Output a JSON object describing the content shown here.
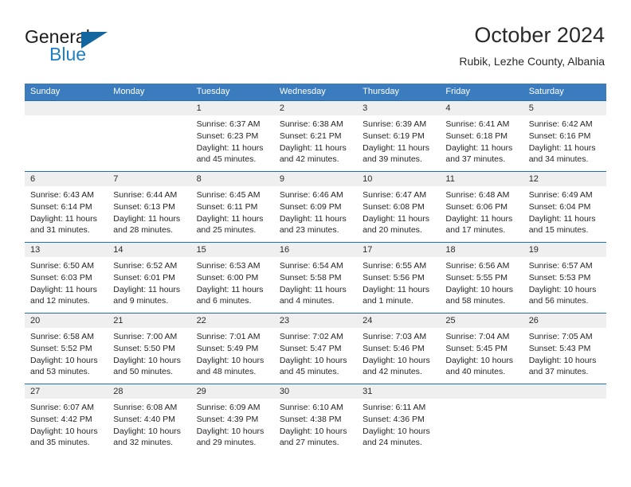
{
  "brand": {
    "name_part1": "General",
    "name_part2": "Blue",
    "accent_color": "#1f7fc4",
    "triangle_color": "#14679e"
  },
  "header": {
    "title": "October 2024",
    "subtitle": "Rubik, Lezhe County, Albania"
  },
  "calendar": {
    "header_bg": "#3a7cbe",
    "row_divider_color": "#1f6db5",
    "daynum_bg": "#efefef",
    "weekdays": [
      "Sunday",
      "Monday",
      "Tuesday",
      "Wednesday",
      "Thursday",
      "Friday",
      "Saturday"
    ],
    "weeks": [
      {
        "daynums": [
          "",
          "",
          "1",
          "2",
          "3",
          "4",
          "5"
        ],
        "cells": [
          {
            "sunrise": "",
            "sunset": "",
            "daylight": ""
          },
          {
            "sunrise": "",
            "sunset": "",
            "daylight": ""
          },
          {
            "sunrise": "Sunrise: 6:37 AM",
            "sunset": "Sunset: 6:23 PM",
            "daylight": "Daylight: 11 hours and 45 minutes."
          },
          {
            "sunrise": "Sunrise: 6:38 AM",
            "sunset": "Sunset: 6:21 PM",
            "daylight": "Daylight: 11 hours and 42 minutes."
          },
          {
            "sunrise": "Sunrise: 6:39 AM",
            "sunset": "Sunset: 6:19 PM",
            "daylight": "Daylight: 11 hours and 39 minutes."
          },
          {
            "sunrise": "Sunrise: 6:41 AM",
            "sunset": "Sunset: 6:18 PM",
            "daylight": "Daylight: 11 hours and 37 minutes."
          },
          {
            "sunrise": "Sunrise: 6:42 AM",
            "sunset": "Sunset: 6:16 PM",
            "daylight": "Daylight: 11 hours and 34 minutes."
          }
        ]
      },
      {
        "daynums": [
          "6",
          "7",
          "8",
          "9",
          "10",
          "11",
          "12"
        ],
        "cells": [
          {
            "sunrise": "Sunrise: 6:43 AM",
            "sunset": "Sunset: 6:14 PM",
            "daylight": "Daylight: 11 hours and 31 minutes."
          },
          {
            "sunrise": "Sunrise: 6:44 AM",
            "sunset": "Sunset: 6:13 PM",
            "daylight": "Daylight: 11 hours and 28 minutes."
          },
          {
            "sunrise": "Sunrise: 6:45 AM",
            "sunset": "Sunset: 6:11 PM",
            "daylight": "Daylight: 11 hours and 25 minutes."
          },
          {
            "sunrise": "Sunrise: 6:46 AM",
            "sunset": "Sunset: 6:09 PM",
            "daylight": "Daylight: 11 hours and 23 minutes."
          },
          {
            "sunrise": "Sunrise: 6:47 AM",
            "sunset": "Sunset: 6:08 PM",
            "daylight": "Daylight: 11 hours and 20 minutes."
          },
          {
            "sunrise": "Sunrise: 6:48 AM",
            "sunset": "Sunset: 6:06 PM",
            "daylight": "Daylight: 11 hours and 17 minutes."
          },
          {
            "sunrise": "Sunrise: 6:49 AM",
            "sunset": "Sunset: 6:04 PM",
            "daylight": "Daylight: 11 hours and 15 minutes."
          }
        ]
      },
      {
        "daynums": [
          "13",
          "14",
          "15",
          "16",
          "17",
          "18",
          "19"
        ],
        "cells": [
          {
            "sunrise": "Sunrise: 6:50 AM",
            "sunset": "Sunset: 6:03 PM",
            "daylight": "Daylight: 11 hours and 12 minutes."
          },
          {
            "sunrise": "Sunrise: 6:52 AM",
            "sunset": "Sunset: 6:01 PM",
            "daylight": "Daylight: 11 hours and 9 minutes."
          },
          {
            "sunrise": "Sunrise: 6:53 AM",
            "sunset": "Sunset: 6:00 PM",
            "daylight": "Daylight: 11 hours and 6 minutes."
          },
          {
            "sunrise": "Sunrise: 6:54 AM",
            "sunset": "Sunset: 5:58 PM",
            "daylight": "Daylight: 11 hours and 4 minutes."
          },
          {
            "sunrise": "Sunrise: 6:55 AM",
            "sunset": "Sunset: 5:56 PM",
            "daylight": "Daylight: 11 hours and 1 minute."
          },
          {
            "sunrise": "Sunrise: 6:56 AM",
            "sunset": "Sunset: 5:55 PM",
            "daylight": "Daylight: 10 hours and 58 minutes."
          },
          {
            "sunrise": "Sunrise: 6:57 AM",
            "sunset": "Sunset: 5:53 PM",
            "daylight": "Daylight: 10 hours and 56 minutes."
          }
        ]
      },
      {
        "daynums": [
          "20",
          "21",
          "22",
          "23",
          "24",
          "25",
          "26"
        ],
        "cells": [
          {
            "sunrise": "Sunrise: 6:58 AM",
            "sunset": "Sunset: 5:52 PM",
            "daylight": "Daylight: 10 hours and 53 minutes."
          },
          {
            "sunrise": "Sunrise: 7:00 AM",
            "sunset": "Sunset: 5:50 PM",
            "daylight": "Daylight: 10 hours and 50 minutes."
          },
          {
            "sunrise": "Sunrise: 7:01 AM",
            "sunset": "Sunset: 5:49 PM",
            "daylight": "Daylight: 10 hours and 48 minutes."
          },
          {
            "sunrise": "Sunrise: 7:02 AM",
            "sunset": "Sunset: 5:47 PM",
            "daylight": "Daylight: 10 hours and 45 minutes."
          },
          {
            "sunrise": "Sunrise: 7:03 AM",
            "sunset": "Sunset: 5:46 PM",
            "daylight": "Daylight: 10 hours and 42 minutes."
          },
          {
            "sunrise": "Sunrise: 7:04 AM",
            "sunset": "Sunset: 5:45 PM",
            "daylight": "Daylight: 10 hours and 40 minutes."
          },
          {
            "sunrise": "Sunrise: 7:05 AM",
            "sunset": "Sunset: 5:43 PM",
            "daylight": "Daylight: 10 hours and 37 minutes."
          }
        ]
      },
      {
        "daynums": [
          "27",
          "28",
          "29",
          "30",
          "31",
          "",
          ""
        ],
        "cells": [
          {
            "sunrise": "Sunrise: 6:07 AM",
            "sunset": "Sunset: 4:42 PM",
            "daylight": "Daylight: 10 hours and 35 minutes."
          },
          {
            "sunrise": "Sunrise: 6:08 AM",
            "sunset": "Sunset: 4:40 PM",
            "daylight": "Daylight: 10 hours and 32 minutes."
          },
          {
            "sunrise": "Sunrise: 6:09 AM",
            "sunset": "Sunset: 4:39 PM",
            "daylight": "Daylight: 10 hours and 29 minutes."
          },
          {
            "sunrise": "Sunrise: 6:10 AM",
            "sunset": "Sunset: 4:38 PM",
            "daylight": "Daylight: 10 hours and 27 minutes."
          },
          {
            "sunrise": "Sunrise: 6:11 AM",
            "sunset": "Sunset: 4:36 PM",
            "daylight": "Daylight: 10 hours and 24 minutes."
          },
          {
            "sunrise": "",
            "sunset": "",
            "daylight": ""
          },
          {
            "sunrise": "",
            "sunset": "",
            "daylight": ""
          }
        ]
      }
    ]
  }
}
